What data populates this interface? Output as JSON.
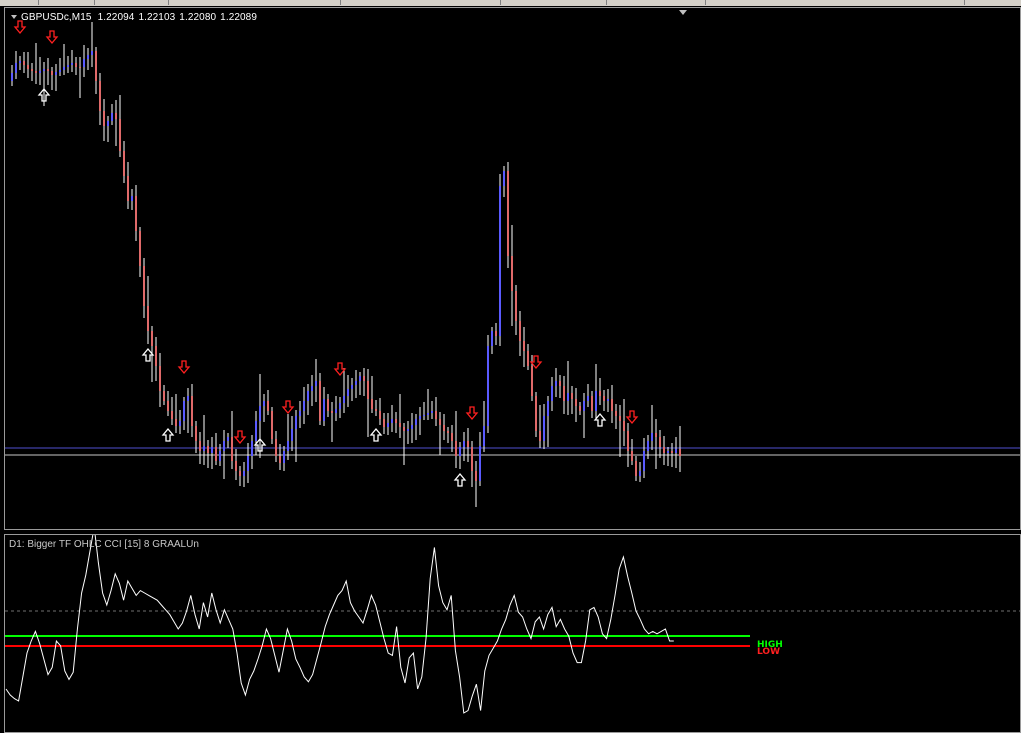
{
  "window": {
    "symbol": "GBPUSDc,M15",
    "open": "1.22094",
    "high": "1.22103",
    "low": "1.22080",
    "close": "1.22089"
  },
  "indicator": {
    "label": "D1: Bigger TF OHLC CCI [15] 8  GRAALUn",
    "high_label": "HIGH",
    "low_label": "LOW"
  },
  "colors": {
    "background": "#000000",
    "bull_candle": "#5b5bff",
    "bear_candle": "#e06a6a",
    "down_arrow": "#ff2020",
    "up_arrow": "#ffffff",
    "high_level": "#00ff00",
    "low_level": "#ff0000",
    "cci_line": "#ffffff",
    "horizontal_line": "#5050d0"
  },
  "chart_data": [
    {
      "type": "candlestick",
      "symbol": "GBPUSDc",
      "timeframe": "M15",
      "ohlc_current": [
        1.22094,
        1.22103,
        1.2208,
        1.22089
      ],
      "price_path": [
        80,
        72,
        62,
        60,
        64,
        68,
        70,
        72,
        70,
        68,
        70,
        74,
        71,
        69,
        66,
        64,
        62,
        66,
        66,
        58,
        54,
        50,
        80,
        110,
        125,
        120,
        112,
        118,
        150,
        175,
        200,
        195,
        230,
        265,
        305,
        330,
        345,
        365,
        390,
        400,
        410,
        418,
        425,
        420,
        400,
        395,
        425,
        440,
        450,
        445,
        452,
        446,
        460,
        450,
        440,
        436,
        460,
        470,
        475,
        470,
        455,
        440,
        420,
        405,
        400,
        410,
        438,
        455,
        462,
        450,
        440,
        428,
        415,
        410,
        400,
        390,
        385,
        380,
        420,
        398,
        410,
        412,
        408,
        402,
        395,
        388,
        384,
        380,
        375,
        380,
        398,
        408,
        410,
        418,
        426,
        422,
        418,
        422,
        426,
        430,
        428,
        424,
        418,
        415,
        414,
        412,
        410,
        418,
        424,
        430,
        432,
        440,
        455,
        446,
        440,
        446,
        470,
        480,
        445,
        425,
        345,
        330,
        335,
        185,
        170,
        255,
        290,
        320,
        340,
        350,
        365,
        395,
        430,
        440,
        415,
        400,
        385,
        380,
        385,
        400,
        392,
        398,
        405,
        410,
        400,
        395,
        410,
        390,
        395,
        400,
        398,
        410,
        415,
        420,
        430,
        450,
        460,
        475,
        470,
        450,
        440,
        432,
        436,
        446,
        452,
        450,
        452,
        448,
        455
      ],
      "down_arrow_bars": [
        3,
        11,
        44,
        58,
        70,
        83,
        116,
        132,
        156
      ],
      "up_arrow_bars": [
        9,
        35,
        40,
        63,
        92,
        113,
        148
      ]
    },
    {
      "type": "line",
      "name": "Bigger TF OHLC CCI",
      "levels": [
        {
          "name": "HIGH",
          "color": "#00ff00"
        },
        {
          "name": "LOW",
          "color": "#ff0000"
        }
      ],
      "values": [
        30,
        25,
        22,
        20,
        40,
        60,
        70,
        78,
        68,
        55,
        42,
        48,
        70,
        66,
        45,
        38,
        44,
        80,
        110,
        125,
        145,
        165,
        135,
        110,
        100,
        112,
        126,
        118,
        104,
        120,
        114,
        108,
        112,
        110,
        108,
        106,
        104,
        100,
        96,
        92,
        86,
        80,
        85,
        95,
        108,
        92,
        80,
        102,
        90,
        110,
        96,
        85,
        96,
        88,
        80,
        60,
        35,
        25,
        38,
        45,
        55,
        66,
        80,
        72,
        58,
        44,
        62,
        80,
        70,
        55,
        48,
        40,
        36,
        42,
        55,
        68,
        82,
        92,
        100,
        108,
        112,
        120,
        102,
        95,
        90,
        85,
        96,
        108,
        100,
        86,
        72,
        60,
        58,
        82,
        48,
        35,
        56,
        60,
        30,
        40,
        72,
        122,
        148,
        116,
        102,
        96,
        108,
        62,
        40,
        10,
        12,
        24,
        34,
        12,
        45,
        58,
        64,
        70,
        80,
        88,
        100,
        108,
        94,
        90,
        80,
        72,
        86,
        90,
        80,
        92,
        98,
        82,
        88,
        80,
        74,
        60,
        52,
        52,
        70,
        96,
        98,
        90,
        76,
        72,
        88,
        108,
        130,
        140,
        124,
        110,
        95,
        88,
        80,
        76,
        78,
        76,
        78,
        80,
        70,
        70
      ]
    }
  ]
}
